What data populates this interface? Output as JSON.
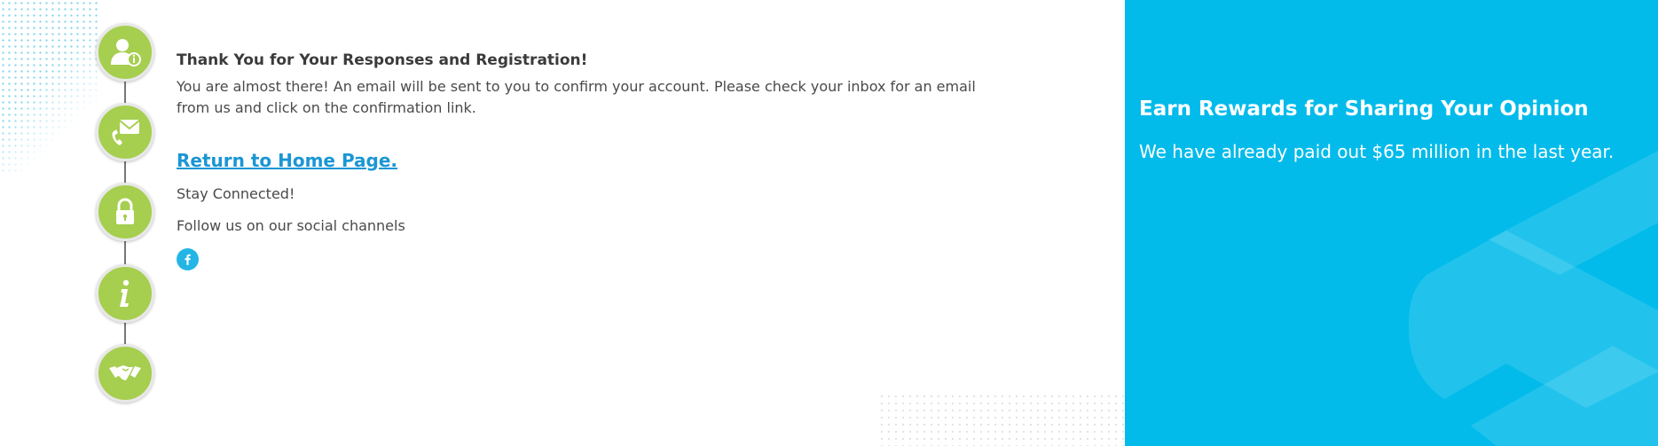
{
  "confirmation": {
    "title": "Thank You for Your Responses and Registration!",
    "message": "You are almost there! An email will be sent to you to confirm your account. Please check your inbox for an email from us and click on the confirmation link.",
    "home_link": "Return to Home Page.",
    "stay_connected": "Stay Connected!",
    "follow_text": "Follow us on our social channels"
  },
  "social": {
    "icon": "facebook-icon"
  },
  "steps": [
    {
      "icon": "user-info-icon"
    },
    {
      "icon": "email-phone-icon"
    },
    {
      "icon": "lock-icon"
    },
    {
      "icon": "info-icon"
    },
    {
      "icon": "handshake-icon"
    }
  ],
  "promo": {
    "title": "Earn Rewards for Sharing Your Opinion",
    "subtitle": "We have already paid out $65 million in the last year."
  },
  "colors": {
    "step_green": "#a6ce4f",
    "link_blue": "#1a96d4",
    "promo_blue": "#03bbea",
    "facebook_blue": "#23b5e6"
  }
}
